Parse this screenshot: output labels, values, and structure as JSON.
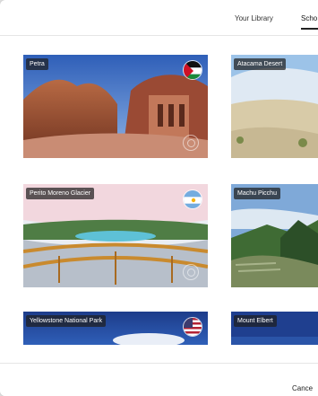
{
  "tabs": {
    "library_label": "Your Library",
    "school_label": "Scho"
  },
  "cards": [
    {
      "title": "Petra",
      "flag": "jordan-flag-icon"
    },
    {
      "title": "Atacama Desert"
    },
    {
      "title": "Perito Moreno Glacier",
      "flag": "argentina-flag-icon"
    },
    {
      "title": "Machu Picchu"
    },
    {
      "title": "Yellowstone National Park",
      "flag": "usa-flag-icon"
    },
    {
      "title": "Mount Elbert"
    }
  ],
  "footer": {
    "cancel_label": "Cance"
  }
}
